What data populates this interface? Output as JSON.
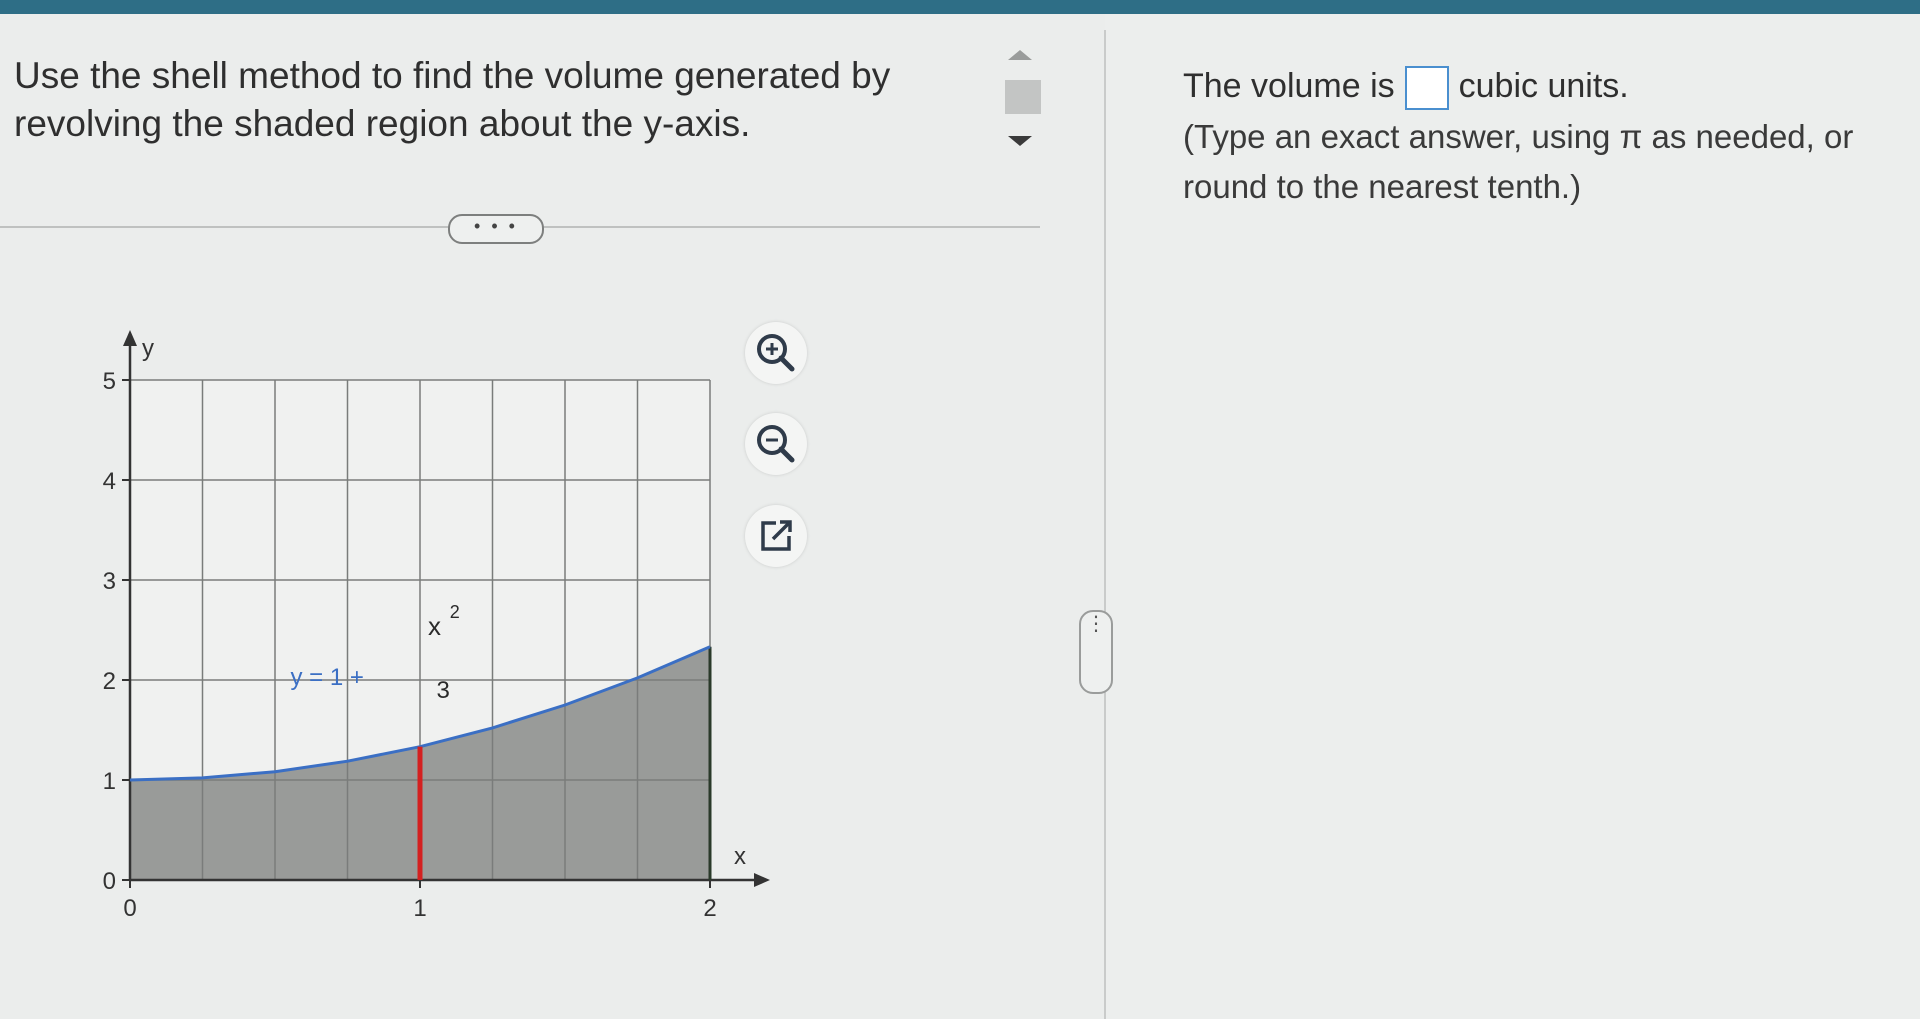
{
  "question": {
    "text": "Use the shell method to find the volume generated by revolving the shaded region about the y-axis."
  },
  "more_button": {
    "label": "• • •"
  },
  "tools": {
    "zoom_in": "zoom-in-icon",
    "zoom_out": "zoom-out-icon",
    "popout": "popout-icon"
  },
  "answer": {
    "prefix": "The volume is",
    "suffix": "cubic units.",
    "input_value": "",
    "hint": "(Type an exact answer, using π as needed, or round to the nearest tenth.)"
  },
  "side_handle": {
    "label": "⋮"
  },
  "colors": {
    "curve": "#3b6fc4",
    "shell": "#d42020",
    "shade": "#8a8c8a"
  },
  "chart_data": {
    "type": "area",
    "function_label": {
      "lhs": "y = 1 +",
      "numerator": "x",
      "exponent": "2",
      "denominator": "3"
    },
    "x_label": "x",
    "y_label": "y",
    "xlim": [
      0,
      2
    ],
    "ylim": [
      0,
      5
    ],
    "x_ticks": [
      0,
      1,
      2
    ],
    "y_ticks": [
      0,
      1,
      2,
      3,
      4,
      5
    ],
    "x_tick_labels": [
      "0",
      "1",
      "2"
    ],
    "y_tick_labels": [
      "0",
      "1",
      "2",
      "3",
      "4",
      "5"
    ],
    "grid_step_x": 0.25,
    "grid_step_y": 1,
    "curve_points": [
      {
        "x": 0,
        "y": 1
      },
      {
        "x": 0.25,
        "y": 1.021
      },
      {
        "x": 0.5,
        "y": 1.083
      },
      {
        "x": 0.75,
        "y": 1.188
      },
      {
        "x": 1,
        "y": 1.333
      },
      {
        "x": 1.25,
        "y": 1.521
      },
      {
        "x": 1.5,
        "y": 1.75
      },
      {
        "x": 1.75,
        "y": 2.021
      },
      {
        "x": 2,
        "y": 2.333
      }
    ],
    "shell_x": 1,
    "shaded": "region between curve and x-axis from x=0 to x=2"
  }
}
